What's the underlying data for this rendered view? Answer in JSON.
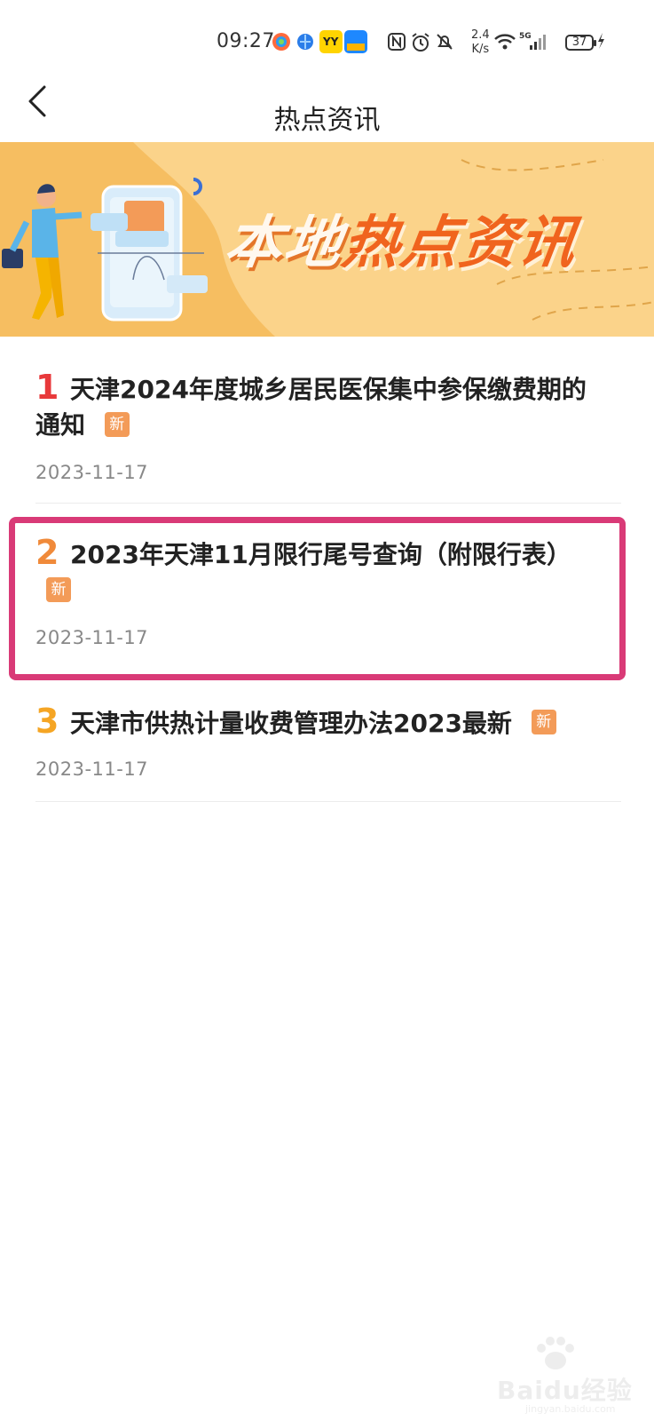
{
  "status_bar": {
    "time": "09:27",
    "net_speed_value": "2.4",
    "net_speed_unit": "K/s",
    "battery": "37",
    "icons": [
      "app-icon",
      "app-icon",
      "yy-app-icon",
      "app-icon",
      "nfc-icon",
      "alarm-icon",
      "mute-icon",
      "wifi-icon",
      "signal-icon",
      "battery-icon",
      "charging-icon"
    ]
  },
  "header": {
    "title": "热点资讯"
  },
  "banner": {
    "text_white": "本地",
    "text_orange": "热点资讯"
  },
  "news": [
    {
      "rank": "1",
      "rank_color": "#e8393b",
      "title_line1": "天津2024年度城乡居民医保集中参保缴费期的",
      "title_line2": "通知",
      "badge": "新",
      "date": "2023-11-17"
    },
    {
      "rank": "2",
      "rank_color": "#f08a3a",
      "title_line1": "2023年天津11月限行尾号查询（附限行表）",
      "badge": "新",
      "date": "2023-11-17"
    },
    {
      "rank": "3",
      "rank_color": "#f5a524",
      "title_line1": "天津市供热计量收费管理办法2023最新",
      "badge": "新",
      "date": "2023-11-17"
    }
  ],
  "watermark": {
    "text": "Baidu经验",
    "sub": "jingyan.baidu.com"
  },
  "colors": {
    "highlight_border": "#d93a77",
    "banner_bg": "#fbd38a",
    "badge_bg": "#f39b58"
  }
}
